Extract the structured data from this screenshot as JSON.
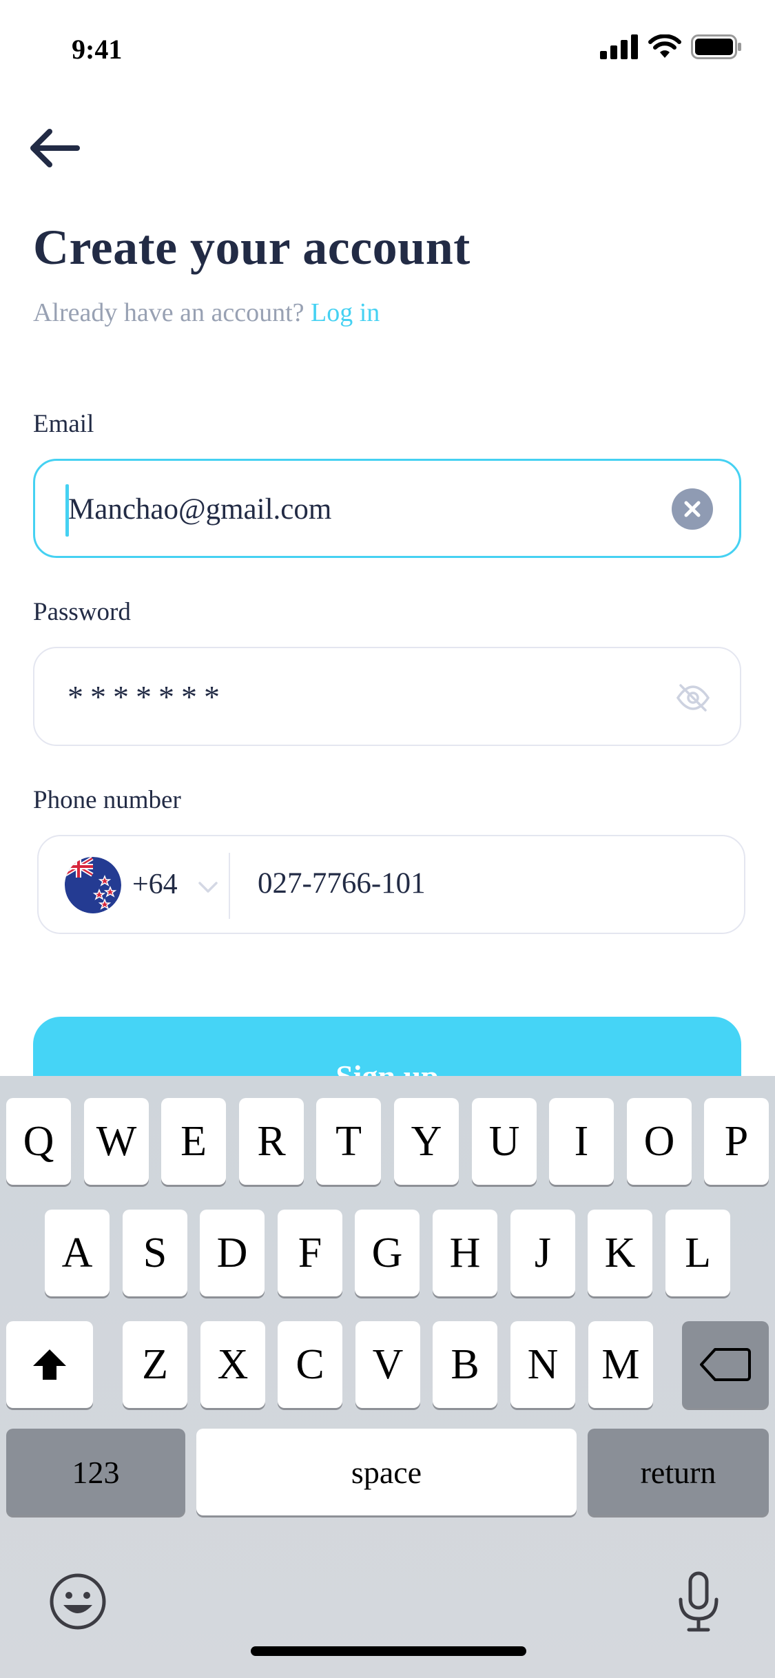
{
  "status_bar": {
    "time": "9:41"
  },
  "header": {
    "title": "Create your account",
    "subtitle_prefix": "Already have an account? ",
    "login_link": "Log in"
  },
  "form": {
    "email": {
      "label": "Email",
      "value": "Manchao@gmail.com"
    },
    "password": {
      "label": "Password",
      "masked_value": "*******"
    },
    "phone": {
      "label": "Phone number",
      "country_code": "+64",
      "country_flag": "new-zealand-flag-icon",
      "value": "027-7766-101"
    }
  },
  "actions": {
    "signup_label": "Sign up"
  },
  "keyboard": {
    "row1": [
      "Q",
      "W",
      "E",
      "R",
      "T",
      "Y",
      "U",
      "I",
      "O",
      "P"
    ],
    "row2": [
      "A",
      "S",
      "D",
      "F",
      "G",
      "H",
      "J",
      "K",
      "L"
    ],
    "row3": [
      "Z",
      "X",
      "C",
      "V",
      "B",
      "N",
      "M"
    ],
    "numbers_label": "123",
    "space_label": "space",
    "return_label": "return"
  },
  "colors": {
    "accent": "#45d1f2",
    "button": "#45d4f6",
    "text": "#222b45",
    "muted": "#98a1b3"
  }
}
